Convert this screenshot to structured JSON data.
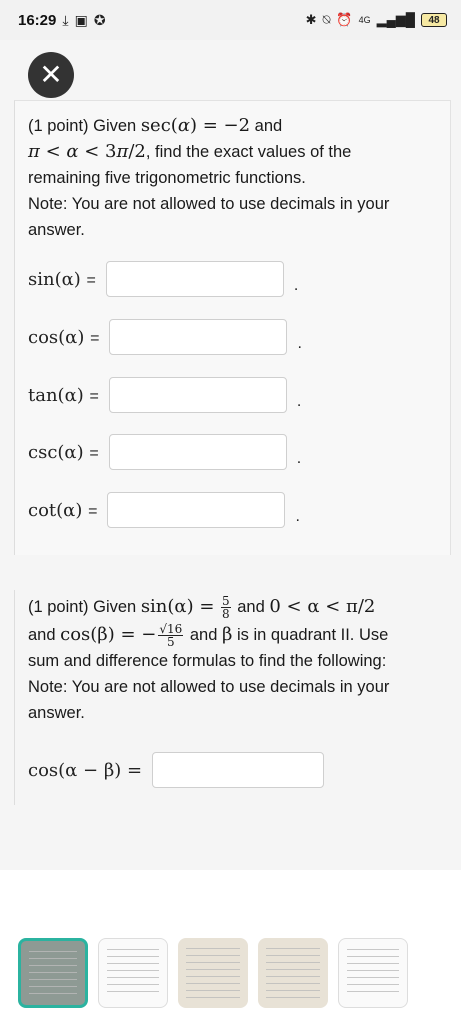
{
  "status_bar": {
    "time": "16:29",
    "network": "4G",
    "battery": "48"
  },
  "problem1": {
    "prompt_lines": [
      "(1 point) Given sec(α) = −2 and",
      "π < α < 3π/2, find the exact values of the",
      "remaining five trigonometric functions.",
      "Note: You are not allowed to use decimals in your",
      "answer."
    ],
    "rows": [
      {
        "label": "sin(α)",
        "eq": "=",
        "value": "",
        "period": "."
      },
      {
        "label": "cos(α)",
        "eq": "=",
        "value": "",
        "period": "."
      },
      {
        "label": "tan(α)",
        "eq": "=",
        "value": "",
        "period": "."
      },
      {
        "label": "csc(α)",
        "eq": "=",
        "value": "",
        "period": "."
      },
      {
        "label": "cot(α)",
        "eq": "=",
        "value": "",
        "period": "."
      }
    ]
  },
  "problem2": {
    "line1_prefix": "(1 point) Given ",
    "line1_math": "sin(α) =",
    "frac1_num": "5",
    "frac1_den": "8",
    "line1_and": " and ",
    "line1_range": "0 < α < π/2",
    "line2_and": "and ",
    "line2_math": "cos(β) = −",
    "frac2_num": "√16",
    "frac2_den": "5",
    "line2_rest1": " and ",
    "line2_beta": "β",
    "line2_rest2": " is in quadrant II. Use",
    "line3": "sum and difference formulas to find the following:",
    "line4": "Note: You are not allowed to use decimals in your",
    "line5": "answer.",
    "answer_label": "cos(α − β) =",
    "answer_value": ""
  }
}
